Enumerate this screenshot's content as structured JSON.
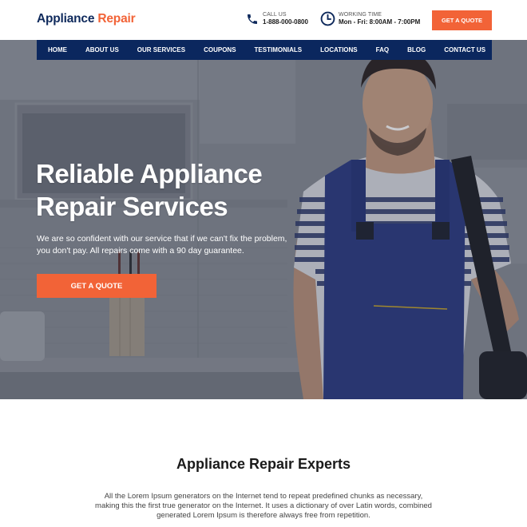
{
  "brand": {
    "name_part1": "Appliance",
    "name_part2": "Repair",
    "colors": {
      "navy": "#0b275e",
      "accent": "#f26337"
    }
  },
  "header": {
    "call": {
      "icon": "phone-icon",
      "label": "CALL US",
      "value": "1-888-000-0800"
    },
    "hours": {
      "icon": "clock-icon",
      "label": "WORKING TIME",
      "value": "Mon - Fri: 8:00AM - 7:00PM"
    },
    "quote_button": "GET A QUOTE"
  },
  "nav": {
    "items": [
      {
        "label": "HOME"
      },
      {
        "label": "ABOUT US"
      },
      {
        "label": "OUR SERVICES"
      },
      {
        "label": "COUPONS"
      },
      {
        "label": "TESTIMONIALS"
      },
      {
        "label": "LOCATIONS"
      },
      {
        "label": "FAQ"
      },
      {
        "label": "BLOG"
      },
      {
        "label": "CONTACT US"
      }
    ]
  },
  "hero": {
    "title_line1": "Reliable Appliance",
    "title_line2": "Repair Services",
    "subtitle_line1": "We are so confident with our service that if we can't fix the problem,",
    "subtitle_line2": "you don't pay. All repairs come with a 90 day guarantee.",
    "quote_button": "GET A QUOTE",
    "image_alt": "smiling repair technician in striped shirt and blue overalls in a kitchen"
  },
  "experts": {
    "title": "Appliance Repair Experts",
    "line1": "All the Lorem Ipsum generators on the Internet tend to repeat predefined chunks as necessary,",
    "line2": "making this the first true generator on the Internet. It uses a dictionary of over Latin words, combined",
    "line3": "generated Lorem Ipsum is therefore always free from repetition."
  }
}
